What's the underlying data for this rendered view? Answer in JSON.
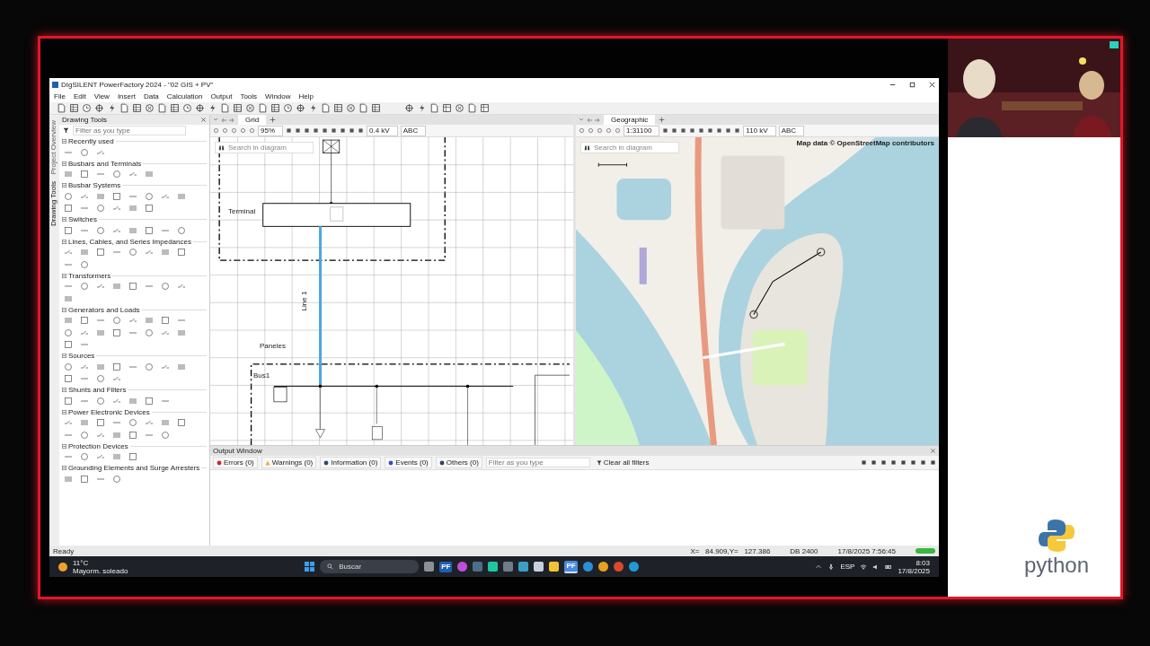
{
  "window": {
    "title": "DIgSILENT PowerFactory 2024 - \"02 GIS + PV\""
  },
  "menu": [
    "File",
    "Edit",
    "View",
    "Insert",
    "Data",
    "Calculation",
    "Output",
    "Tools",
    "Window",
    "Help"
  ],
  "drawing_tools": {
    "title": "Drawing Tools",
    "filter_placeholder": "Filter as you type",
    "side_tabs": [
      {
        "label": "Project Overview",
        "selected": false
      },
      {
        "label": "Drawing Tools",
        "selected": true
      }
    ],
    "sections": [
      {
        "title": "Recently used",
        "expanded": true
      },
      {
        "title": "Busbars and Terminals",
        "expanded": true
      },
      {
        "title": "Busbar Systems",
        "expanded": true
      },
      {
        "title": "Switches",
        "expanded": true
      },
      {
        "title": "Lines, Cables, and Series Impedances",
        "expanded": true
      },
      {
        "title": "Transformers",
        "expanded": true
      },
      {
        "title": "Generators and Loads",
        "expanded": true
      },
      {
        "title": "Sources",
        "expanded": true
      },
      {
        "title": "Shunts and Filters",
        "expanded": true
      },
      {
        "title": "Power Electronic Devices",
        "expanded": true
      },
      {
        "title": "Protection Devices",
        "expanded": true
      },
      {
        "title": "Grounding Elements and Surge Arresters",
        "expanded": true
      }
    ]
  },
  "grid_pane": {
    "tab": {
      "label": "Grid",
      "selected": true
    },
    "zoom": "95%",
    "voltage": "0.4 kV",
    "text_mode": "ABC",
    "search_placeholder": "Search in diagram",
    "labels": {
      "terminal": "Terminal",
      "line": "Line 1",
      "panels": "Paneles",
      "bus": "Bus1"
    }
  },
  "geo_pane": {
    "tab": {
      "label": "Geographic",
      "selected": true
    },
    "scale": "1:31100",
    "voltage": "110 kV",
    "text_mode": "ABC",
    "search_placeholder": "Search in diagram",
    "attribution": "Map data © OpenStreetMap contributors"
  },
  "output_window": {
    "title": "Output Window",
    "filters": [
      {
        "kind": "error",
        "label": "Errors (0)"
      },
      {
        "kind": "warning",
        "label": "Warnings (0)"
      },
      {
        "kind": "info",
        "label": "Information (0)"
      },
      {
        "kind": "event",
        "label": "Events (0)"
      },
      {
        "kind": "other",
        "label": "Others (0)"
      }
    ],
    "filter_placeholder": "Filter as you type",
    "clear": "Clear all filters"
  },
  "status_bar": {
    "text": "Ready",
    "coords": "X=   84.909,Y=   127.386",
    "db": "DB 2400",
    "timestamp": "17/8/2025 7:56:45"
  },
  "taskbar": {
    "weather_temp": "11°C",
    "weather_text": "Mayorm. soleado",
    "search_placeholder": "Buscar",
    "apps": [
      {
        "kind": "tile",
        "color": "#8a8f98",
        "selected": false
      },
      {
        "kind": "pf",
        "label": "PF",
        "selected": false
      },
      {
        "kind": "round",
        "color": "#c04fd8",
        "selected": false
      },
      {
        "kind": "tile",
        "color": "#4a6f8a",
        "selected": false
      },
      {
        "kind": "tile",
        "color": "#1fc7a0",
        "selected": false
      },
      {
        "kind": "tile",
        "color": "#6f7c8c",
        "selected": false
      },
      {
        "kind": "tile",
        "color": "#3aa0c8",
        "selected": false
      },
      {
        "kind": "tile",
        "color": "#c8d0e0",
        "selected": false
      },
      {
        "kind": "tile",
        "color": "#f2c230",
        "selected": false
      },
      {
        "kind": "pf",
        "label": "PF",
        "selected": true
      },
      {
        "kind": "round",
        "color": "#2d8fd8",
        "selected": false
      },
      {
        "kind": "round",
        "color": "#e8a020",
        "selected": false
      },
      {
        "kind": "round",
        "color": "#d84a2a",
        "selected": false
      },
      {
        "kind": "round",
        "color": "#1f9ad8",
        "selected": false
      }
    ],
    "language": "ESP",
    "time": "8:03",
    "date": "17/8/2025"
  },
  "overlay": {
    "logo_text": "python"
  }
}
